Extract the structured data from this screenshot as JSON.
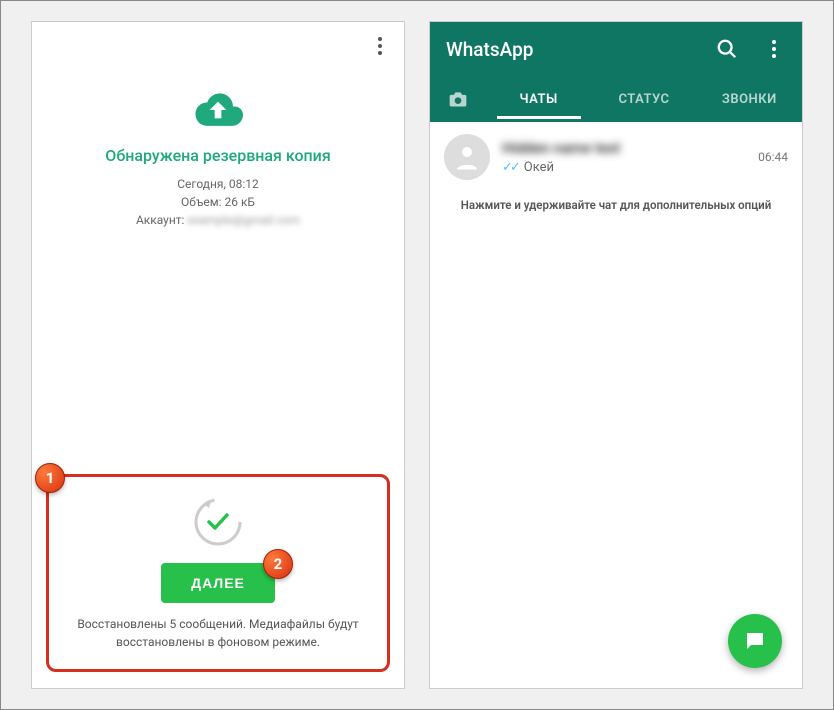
{
  "left": {
    "title": "Обнаружена резервная копия",
    "meta_date": "Сегодня, 08:12",
    "meta_size": "Объем: 26 кБ",
    "meta_account_label": "Аккаунт:",
    "meta_account_value": "example@gmail.com",
    "next_button": "ДАЛЕЕ",
    "restore_text": "Восстановлены 5 сообщений. Медиафайлы будут восстановлены в фоновом режиме.",
    "badge1": "1",
    "badge2": "2"
  },
  "right": {
    "app_title": "WhatsApp",
    "tabs": {
      "chats": "ЧАТЫ",
      "status": "СТАТУС",
      "calls": "ЗВОНКИ"
    },
    "chat": {
      "name": "Hidden name text",
      "message": "Окей",
      "time": "06:44"
    },
    "hint": "Нажмите и удерживайте чат для дополнительных опций"
  },
  "colors": {
    "teal": "#0f7663",
    "green_accent": "#1fa97d",
    "green_btn": "#27c04a",
    "red_border": "#d62f1f"
  }
}
